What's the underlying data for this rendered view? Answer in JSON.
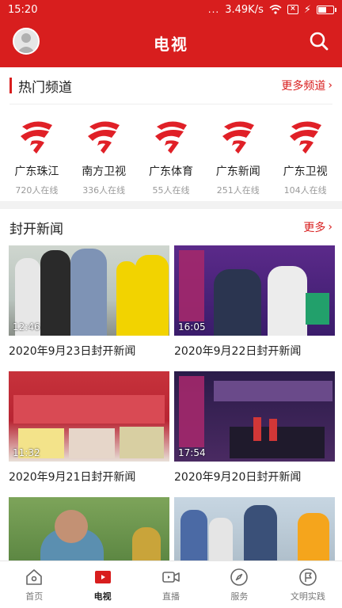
{
  "status": {
    "time": "15:20",
    "signal_dots": "...",
    "network_speed": "3.49K/s"
  },
  "header": {
    "title": "电视",
    "avatar_icon": "avatar-icon",
    "search_icon": "search-icon"
  },
  "hot_channels": {
    "title": "热门频道",
    "more_label": "更多频道",
    "items": [
      {
        "name": "广东珠江",
        "count": "720人在线"
      },
      {
        "name": "南方卫视",
        "count": "336人在线"
      },
      {
        "name": "广东体育",
        "count": "55人在线"
      },
      {
        "name": "广东新闻",
        "count": "251人在线"
      },
      {
        "name": "广东卫视",
        "count": "104人在线"
      }
    ]
  },
  "news": {
    "title": "封开新闻",
    "more_label": "更多",
    "items": [
      {
        "title": "2020年9月23日封开新闻",
        "duration": "12:46"
      },
      {
        "title": "2020年9月22日封开新闻",
        "duration": "16:05"
      },
      {
        "title": "2020年9月21日封开新闻",
        "duration": "11:32"
      },
      {
        "title": "2020年9月20日封开新闻",
        "duration": "17:54"
      },
      {
        "title": "",
        "duration": ""
      },
      {
        "title": "",
        "duration": ""
      }
    ]
  },
  "bottom_nav": [
    {
      "label": "首页",
      "icon": "home-icon",
      "active": false
    },
    {
      "label": "电视",
      "icon": "tv-play-icon",
      "active": true
    },
    {
      "label": "直播",
      "icon": "live-video-icon",
      "active": false
    },
    {
      "label": "服务",
      "icon": "compass-icon",
      "active": false
    },
    {
      "label": "文明实践",
      "icon": "flag-circle-icon",
      "active": false
    }
  ],
  "colors": {
    "brand_red": "#d81e1e",
    "text": "#222222",
    "muted": "#999999"
  }
}
